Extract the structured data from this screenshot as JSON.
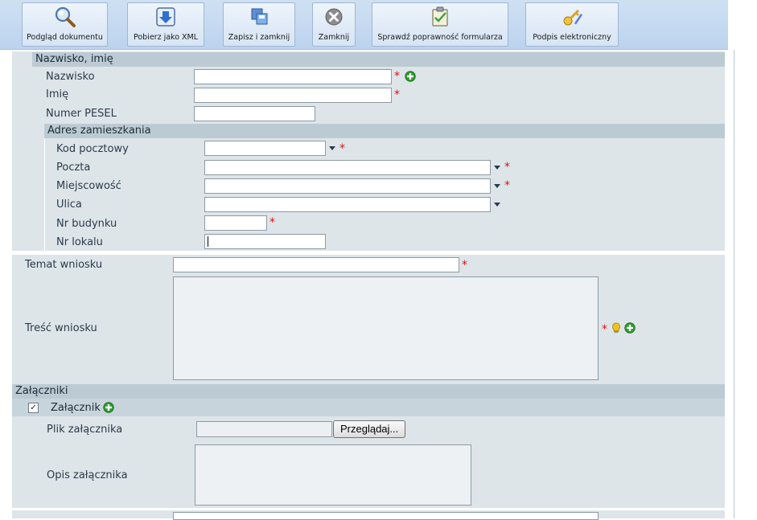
{
  "toolbar": {
    "buttons": [
      {
        "label": "Podgląd dokumentu",
        "icon": "magnifier-icon"
      },
      {
        "label": "Pobierz jako XML",
        "icon": "download-xml-icon"
      },
      {
        "label": "Zapisz i zamknij",
        "icon": "save-close-icon"
      },
      {
        "label": "Zamknij",
        "icon": "close-icon"
      },
      {
        "label": "Sprawdź poprawność formularza",
        "icon": "validate-icon"
      },
      {
        "label": "Podpis elektroniczny",
        "icon": "signature-key-icon"
      }
    ]
  },
  "person": {
    "header": "Nazwisko, imię",
    "surname_label": "Nazwisko",
    "surname_value": "",
    "name_label": "Imię",
    "name_value": "",
    "pesel_label": "Numer PESEL",
    "pesel_value": ""
  },
  "address": {
    "header": "Adres zamieszkania",
    "postal_label": "Kod pocztowy",
    "post_label": "Poczta",
    "city_label": "Miejscowość",
    "street_label": "Ulica",
    "building_label": "Nr budynku",
    "flat_label": "Nr lokalu"
  },
  "request": {
    "subject_label": "Temat wniosku",
    "subject_value": "",
    "content_label": "Treść wniosku",
    "content_value": ""
  },
  "attachments": {
    "header": "Załączniki",
    "item_label": "Załącznik",
    "item_checked_glyph": "✓",
    "file_label": "Plik załącznika",
    "browse_label": "Przeglądaj...",
    "desc_label": "Opis załącznika"
  },
  "required_mark": "*",
  "colors": {
    "required": "#e01010",
    "panel_bg": "#dde5e9",
    "section_header_bg": "#bccbd3",
    "toolbar_bg": "#c4d8f0",
    "plus_green": "#2f9a2f"
  }
}
